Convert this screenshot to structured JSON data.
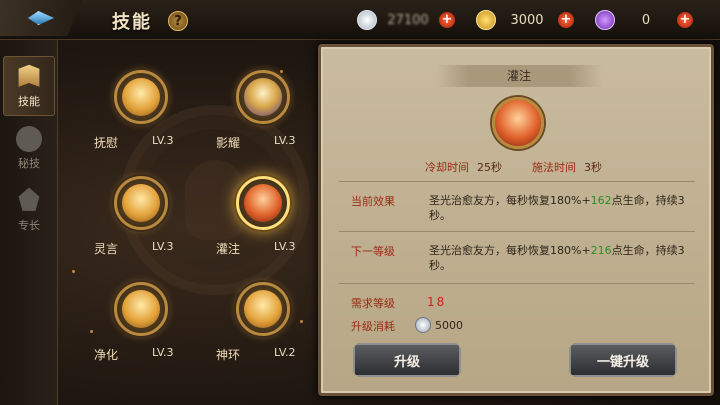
{
  "header": {
    "title": "技能",
    "help_label": "?",
    "resources": {
      "silver": {
        "value": "27100",
        "sub": ""
      },
      "gold": {
        "value": "3000"
      },
      "gem": {
        "value": "0"
      },
      "plus_label": "+"
    }
  },
  "sidebar": {
    "tabs": [
      {
        "label": "技能",
        "active": true
      },
      {
        "label": "秘技",
        "active": false
      },
      {
        "label": "专长",
        "active": false
      }
    ]
  },
  "skills": [
    {
      "name": "抚慰",
      "level": "LV.3"
    },
    {
      "name": "影耀",
      "level": "LV.3"
    },
    {
      "name": "灵言",
      "level": "LV.3"
    },
    {
      "name": "灌注",
      "level": "LV.3",
      "selected": true
    },
    {
      "name": "净化",
      "level": "LV.3"
    },
    {
      "name": "神环",
      "level": "LV.2"
    }
  ],
  "detail": {
    "title": "灌注",
    "cooldown_label": "冷却时间",
    "cooldown_value": "25秒",
    "cast_label": "施法时间",
    "cast_value": "3秒",
    "current_label": "当前效果",
    "current_text_pre": "圣光治愈友方，每秒恢复180%+",
    "current_num": "162",
    "current_text_post": "点生命，持续3秒。",
    "next_label": "下一等级",
    "next_text_pre": "圣光治愈友方，每秒恢复180%+",
    "next_num": "216",
    "next_text_post": "点生命，持续3秒。",
    "req_label": "需求等级",
    "req_value": "18",
    "cost_label": "升级消耗",
    "cost_value": "5000",
    "upgrade_button": "升级",
    "upgrade_all_button": "一键升级"
  },
  "colors": {
    "accent_red": "#9b2a14",
    "green_number": "#2f8a25",
    "req_red": "#d0221a"
  }
}
